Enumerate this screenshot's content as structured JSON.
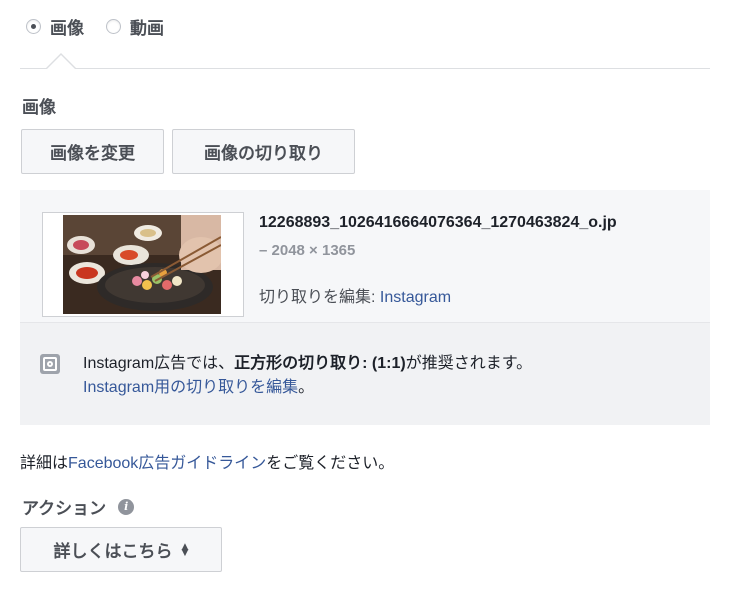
{
  "media_type": {
    "options": [
      {
        "label": "画像",
        "checked": true
      },
      {
        "label": "動画",
        "checked": false
      }
    ]
  },
  "image_section": {
    "label": "画像",
    "change_button": "画像を変更",
    "crop_button": "画像の切り取り"
  },
  "image_file": {
    "filename": "12268893_1026416664076364_1270463824_o.jp",
    "dimensions": "– 2048 × 1365",
    "crop_edit_label": "切り取りを編集: ",
    "crop_edit_link": "Instagram"
  },
  "instagram_notice": {
    "text_1": "Instagram広告では、",
    "bold": "正方形の切り取り: (1:1)",
    "text_2": "が推奨されます。",
    "link": "Instagram用の切り取りを編集",
    "end": "。"
  },
  "guidelines": {
    "prefix": "詳細は",
    "link": "Facebook広告ガイドライン",
    "suffix": "をご覧ください。"
  },
  "action": {
    "label": "アクション",
    "selected": "詳しくはこちら"
  }
}
